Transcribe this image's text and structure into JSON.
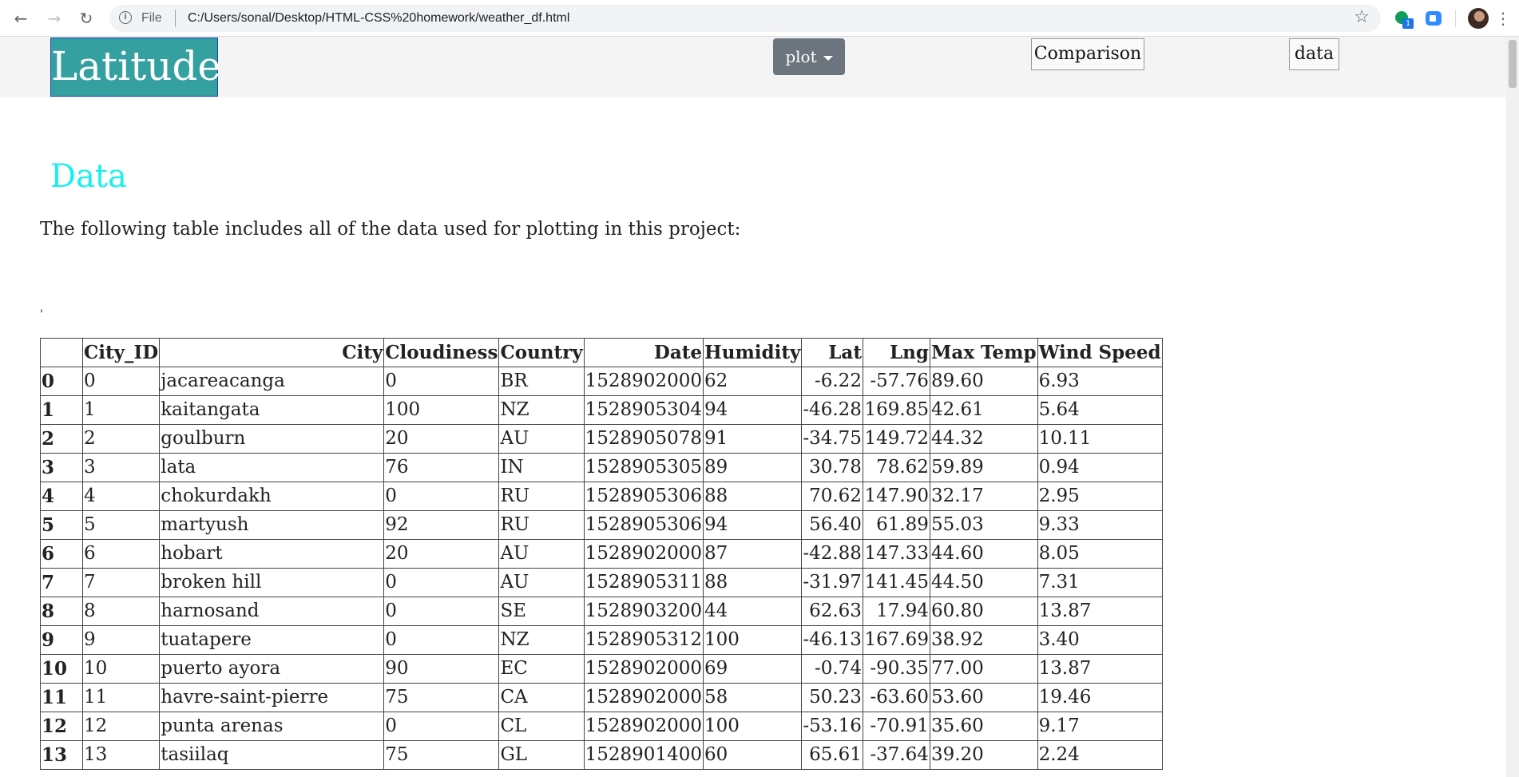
{
  "browser": {
    "scheme": "File",
    "url": "C:/Users/sonal/Desktop/HTML-CSS%20homework/weather_df.html",
    "extension_badge": "1"
  },
  "nav": {
    "brand": "Latitude",
    "dropdown_label": "plot",
    "comparison_label": "Comparison",
    "data_label": "data"
  },
  "page": {
    "heading": "Data",
    "intro": "The following table includes all of the data used for plotting in this project:",
    "stray_mark": "'"
  },
  "table": {
    "columns": [
      "",
      "City_ID",
      "City",
      "Cloudiness",
      "Country",
      "Date",
      "Humidity",
      "Lat",
      "Lng",
      "Max Temp",
      "Wind Speed"
    ],
    "rows": [
      [
        "0",
        "0",
        "jacareacanga",
        "0",
        "BR",
        "1528902000",
        "62",
        "-6.22",
        "-57.76",
        "89.60",
        "6.93"
      ],
      [
        "1",
        "1",
        "kaitangata",
        "100",
        "NZ",
        "1528905304",
        "94",
        "-46.28",
        "169.85",
        "42.61",
        "5.64"
      ],
      [
        "2",
        "2",
        "goulburn",
        "20",
        "AU",
        "1528905078",
        "91",
        "-34.75",
        "149.72",
        "44.32",
        "10.11"
      ],
      [
        "3",
        "3",
        "lata",
        "76",
        "IN",
        "1528905305",
        "89",
        "30.78",
        "78.62",
        "59.89",
        "0.94"
      ],
      [
        "4",
        "4",
        "chokurdakh",
        "0",
        "RU",
        "1528905306",
        "88",
        "70.62",
        "147.90",
        "32.17",
        "2.95"
      ],
      [
        "5",
        "5",
        "martyush",
        "92",
        "RU",
        "1528905306",
        "94",
        "56.40",
        "61.89",
        "55.03",
        "9.33"
      ],
      [
        "6",
        "6",
        "hobart",
        "20",
        "AU",
        "1528902000",
        "87",
        "-42.88",
        "147.33",
        "44.60",
        "8.05"
      ],
      [
        "7",
        "7",
        "broken hill",
        "0",
        "AU",
        "1528905311",
        "88",
        "-31.97",
        "141.45",
        "44.50",
        "7.31"
      ],
      [
        "8",
        "8",
        "harnosand",
        "0",
        "SE",
        "1528903200",
        "44",
        "62.63",
        "17.94",
        "60.80",
        "13.87"
      ],
      [
        "9",
        "9",
        "tuatapere",
        "0",
        "NZ",
        "1528905312",
        "100",
        "-46.13",
        "167.69",
        "38.92",
        "3.40"
      ],
      [
        "10",
        "10",
        "puerto ayora",
        "90",
        "EC",
        "1528902000",
        "69",
        "-0.74",
        "-90.35",
        "77.00",
        "13.87"
      ],
      [
        "11",
        "11",
        "havre-saint-pierre",
        "75",
        "CA",
        "1528902000",
        "58",
        "50.23",
        "-63.60",
        "53.60",
        "19.46"
      ],
      [
        "12",
        "12",
        "punta arenas",
        "0",
        "CL",
        "1528902000",
        "100",
        "-53.16",
        "-70.91",
        "35.60",
        "9.17"
      ],
      [
        "13",
        "13",
        "tasiilaq",
        "75",
        "GL",
        "1528901400",
        "60",
        "65.61",
        "-37.64",
        "39.20",
        "2.24"
      ]
    ]
  }
}
